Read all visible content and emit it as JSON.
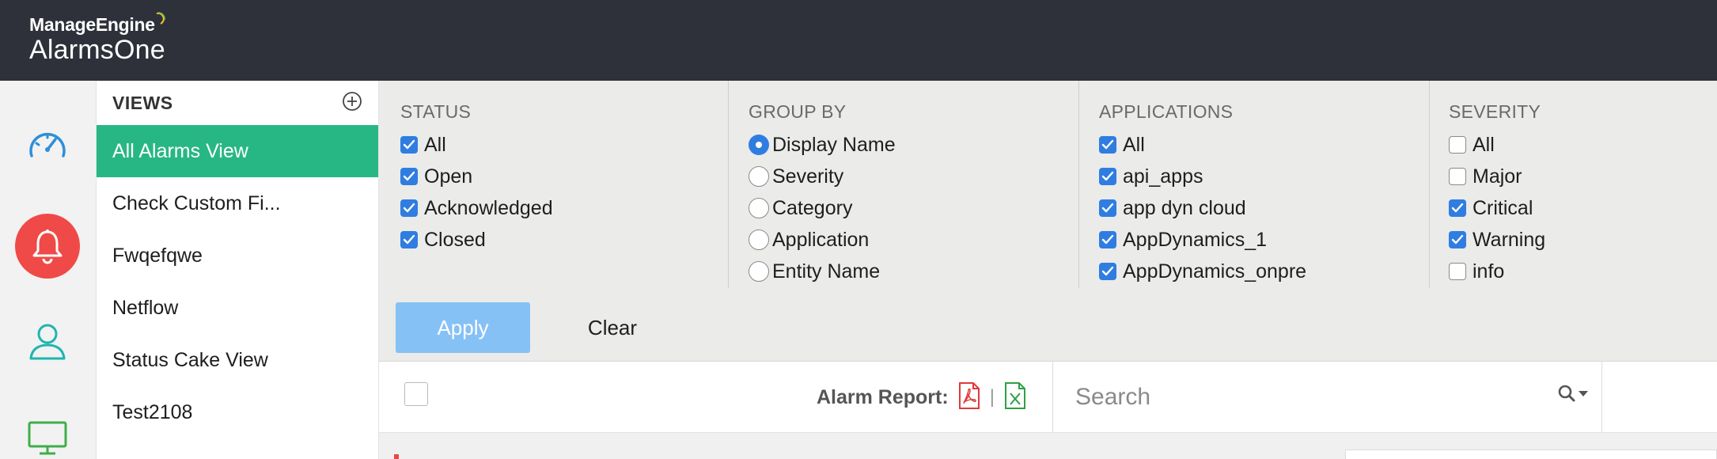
{
  "brand": {
    "company": "ManageEngine",
    "product": "AlarmsOne"
  },
  "rail": {
    "icons": [
      "dashboard-gauge-icon",
      "alarm-bell-icon",
      "user-icon",
      "monitor-icon"
    ],
    "active_color": "#ef4a47"
  },
  "views": {
    "title": "VIEWS",
    "add_icon": "plus-circle-icon",
    "items": [
      {
        "label": "All Alarms View",
        "active": true
      },
      {
        "label": "Check Custom Fi...",
        "active": false
      },
      {
        "label": "Fwqefqwe",
        "active": false
      },
      {
        "label": "Netflow",
        "active": false
      },
      {
        "label": "Status Cake View",
        "active": false
      },
      {
        "label": "Test2108",
        "active": false
      }
    ],
    "active_color": "#27b785"
  },
  "filters": {
    "status": {
      "title": "STATUS",
      "options": [
        {
          "label": "All",
          "checked": true
        },
        {
          "label": "Open",
          "checked": true
        },
        {
          "label": "Acknowledged",
          "checked": true
        },
        {
          "label": "Closed",
          "checked": true
        }
      ]
    },
    "group_by": {
      "title": "GROUP BY",
      "options": [
        {
          "label": "Display Name",
          "selected": true
        },
        {
          "label": "Severity",
          "selected": false
        },
        {
          "label": "Category",
          "selected": false
        },
        {
          "label": "Application",
          "selected": false
        },
        {
          "label": "Entity Name",
          "selected": false
        }
      ]
    },
    "applications": {
      "title": "APPLICATIONS",
      "options": [
        {
          "label": "All",
          "checked": true
        },
        {
          "label": "api_apps",
          "checked": true
        },
        {
          "label": "app dyn cloud",
          "checked": true
        },
        {
          "label": "AppDynamics_1",
          "checked": true
        },
        {
          "label": "AppDynamics_onpre",
          "checked": true
        }
      ]
    },
    "severity": {
      "title": "SEVERITY",
      "options": [
        {
          "label": "All",
          "checked": false
        },
        {
          "label": "Major",
          "checked": false
        },
        {
          "label": "Critical",
          "checked": true
        },
        {
          "label": "Warning",
          "checked": true
        },
        {
          "label": "info",
          "checked": false
        }
      ]
    },
    "apply_label": "Apply",
    "clear_label": "Clear",
    "check_color": "#2f7de1"
  },
  "toolbar": {
    "report_label": "Alarm Report:",
    "pdf_icon": "pdf-file-icon",
    "excel_icon": "excel-file-icon",
    "separator": "|",
    "search_placeholder": "Search",
    "search_icon": "search-dropdown-icon"
  }
}
